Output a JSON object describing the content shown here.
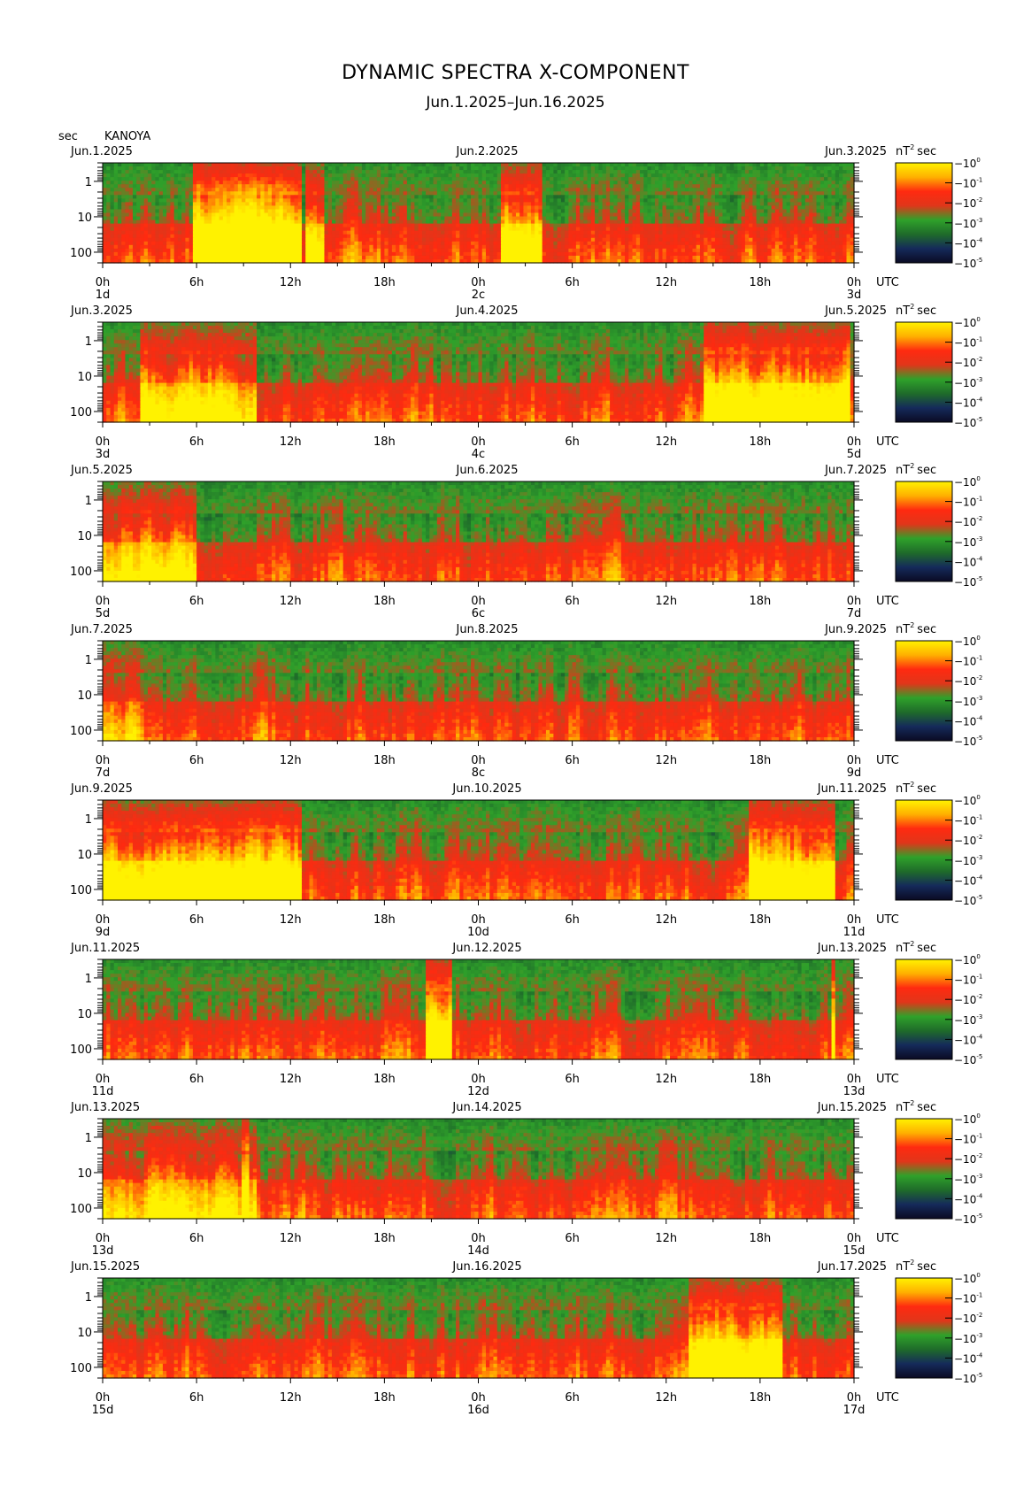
{
  "title": "DYNAMIC SPECTRA X-COMPONENT",
  "subtitle": "Jun.1.2025–Jun.16.2025",
  "axis_unit_label": "sec",
  "station": "KANOYA",
  "colorbar_unit": "nT",
  "colorbar_unit_exp": "2",
  "colorbar_unit_suffix": "sec",
  "colorbar_ticks": [
    {
      "base": "10",
      "exp": "0"
    },
    {
      "base": "10",
      "exp": "-1"
    },
    {
      "base": "10",
      "exp": "-2"
    },
    {
      "base": "10",
      "exp": "-3"
    },
    {
      "base": "10",
      "exp": "-4"
    },
    {
      "base": "10",
      "exp": "-5"
    }
  ],
  "colors": {
    "colormap": [
      "#0a0a23",
      "#152a5a",
      "#1f6b2a",
      "#2fa12a",
      "#e0361a",
      "#ff2a10",
      "#ffb000",
      "#fff200"
    ]
  },
  "chart_data": {
    "type": "heatmap",
    "y_axis": {
      "label": "sec",
      "scale": "log",
      "range": [
        0.3,
        200
      ],
      "ticks": [
        "1",
        "10",
        "100"
      ]
    },
    "x_axis": {
      "ticks": [
        "0h",
        "6h",
        "12h",
        "18h",
        "0h",
        "6h",
        "12h",
        "18h",
        "0h"
      ],
      "unit": "UTC"
    },
    "colorbar": {
      "scale": "log",
      "range": [
        1e-05,
        1
      ]
    },
    "panels": [
      {
        "date_left": "Jun.1.2025",
        "date_mid": "Jun.2.2025",
        "date_right": "Jun.3.2025",
        "days": [
          "1d",
          "2c",
          "3d"
        ],
        "hot_events": [
          [
            0.12,
            0.26,
            0.92
          ],
          [
            0.27,
            0.29,
            0.6
          ],
          [
            0.53,
            0.58,
            0.7
          ],
          [
            0.19,
            0.23,
            0.95
          ]
        ]
      },
      {
        "date_left": "Jun.3.2025",
        "date_mid": "Jun.4.2025",
        "date_right": "Jun.5.2025",
        "days": [
          "3d",
          "4c",
          "5d"
        ],
        "hot_events": [
          [
            0.8,
            0.99,
            0.7
          ],
          [
            0.05,
            0.2,
            0.5
          ]
        ]
      },
      {
        "date_left": "Jun.5.2025",
        "date_mid": "Jun.6.2025",
        "date_right": "Jun.7.2025",
        "days": [
          "5d",
          "6c",
          "7d"
        ],
        "hot_events": [
          [
            0.0,
            0.12,
            0.45
          ]
        ]
      },
      {
        "date_left": "Jun.7.2025",
        "date_mid": "Jun.8.2025",
        "date_right": "Jun.9.2025",
        "days": [
          "7d",
          "8c",
          "9d"
        ],
        "hot_events": [
          [
            0.0,
            0.05,
            0.3
          ]
        ]
      },
      {
        "date_left": "Jun.9.2025",
        "date_mid": "Jun.10.2025",
        "date_right": "Jun.11.2025",
        "days": [
          "9d",
          "10d",
          "11d"
        ],
        "hot_events": [
          [
            0.0,
            0.26,
            0.7
          ],
          [
            0.86,
            0.97,
            0.7
          ]
        ]
      },
      {
        "date_left": "Jun.11.2025",
        "date_mid": "Jun.12.2025",
        "date_right": "Jun.13.2025",
        "days": [
          "11d",
          "12d",
          "13d"
        ],
        "hot_events": [
          [
            0.43,
            0.46,
            0.8
          ],
          [
            0.966,
            0.972,
            1.0
          ]
        ]
      },
      {
        "date_left": "Jun.13.2025",
        "date_mid": "Jun.14.2025",
        "date_right": "Jun.15.2025",
        "days": [
          "13d",
          "14d",
          "15d"
        ],
        "hot_events": [
          [
            0.185,
            0.19,
            1.0
          ],
          [
            0.0,
            0.2,
            0.35
          ]
        ]
      },
      {
        "date_left": "Jun.15.2025",
        "date_mid": "Jun.16.2025",
        "date_right": "Jun.17.2025",
        "days": [
          "15d",
          "16d",
          "17d"
        ],
        "hot_events": [
          [
            0.78,
            0.9,
            0.65
          ]
        ]
      }
    ]
  }
}
